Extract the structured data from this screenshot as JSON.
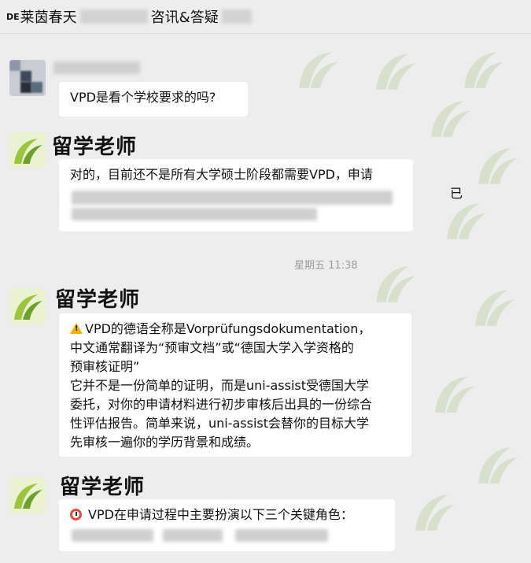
{
  "window": {
    "title_prefix": "DE",
    "title_main": "莱茵春天",
    "title_suffix": "咨讯&答疑"
  },
  "messages": [
    {
      "type": "user",
      "text": "VPD是看个学校要求的吗?"
    },
    {
      "type": "teacher",
      "sender": "留学老师",
      "text": "对的，目前还不是所有大学硕士阶段都需要VPD，申请",
      "partial_visible": "已"
    },
    {
      "type": "timestamp",
      "text": "星期五 11:38"
    },
    {
      "type": "teacher",
      "sender": "留学老师",
      "lines": [
        "VPD的德语全称是Vorprüfungsdokumentation，",
        "中文通常翻译为“预审文档”或“德国大学入学资格的",
        "预审核证明”",
        "它并不是一份简单的证明，而是uni-assist受德国大学",
        "委托，对你的申请材料进行初步审核后出具的一份综合",
        "性评估报告。简单来说，uni-assist会替你的目标大学",
        "先审核一遍你的学历背景和成绩。"
      ],
      "icon": "warning-icon"
    },
    {
      "type": "teacher",
      "sender": "留学老师",
      "text": "VPD在申请过程中主要扮演以下三个关键角色：",
      "icon": "alarm-clock-icon"
    }
  ],
  "colors": {
    "background": "#ededed",
    "bubble": "#ffffff",
    "timestamp": "#9c9c9c",
    "warning": "#f5b400",
    "alarm": "#e84b3c",
    "logo_green": "#9bc53d"
  }
}
